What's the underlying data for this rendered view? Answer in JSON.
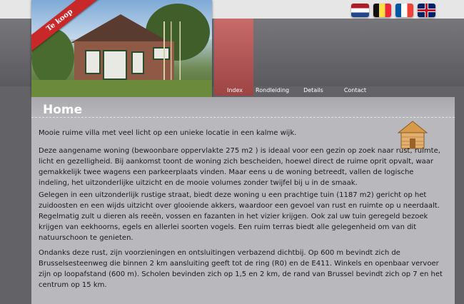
{
  "photo": {
    "ribbon": "Te koop"
  },
  "flags": [
    "nl-flag-icon",
    "be-flag-icon",
    "fr-flag-icon",
    "gb-flag-icon"
  ],
  "nav": {
    "items": [
      "Index",
      "Rondleiding",
      "Details",
      "Contact"
    ]
  },
  "page": {
    "title": "Home"
  },
  "paragraphs": [
    "Mooie ruime villa met veel licht op een unieke locatie in een kalme wijk.",
    "Deze aangename woning (bewoonbare oppervlakte 275 m2 ) is ideaal voor een gezin op zoek naar rust, ruimte, licht en gezelligheid. Bij aankomst toont de woning zich bescheiden, hoewel direct de ruime oprit opvalt, waar gemakkelijk twee wagens een parkeerplaats vinden. Maar eens u de woning betreedt, vallen de logische indeling, het uitzonderlijke uitzicht en de mooie volumes zonder twijfel bij u in de smaak.",
    "Gelegen in een uitzonderlijk rustige straat, biedt deze woning u een prachtige tuin (1187 m2) gericht op het zuidoosten en een wijds uitzicht over glooiende akkers, waardoor een gevoel van rust en ruimte op u neerdaalt. Regelmatig zult u dieren als reeën, vossen en fazanten in het vizier krijgen. Ook zal uw tuin geregeld bezoek krijgen van eekhoorns, egels en allerlei soorten vogels. Een ruim terras biedt alle gelegenheid om van dit natuurschoon te genieten.",
    "Ondanks deze rust, zijn voorzieningen en ontsluitingen verbazend dichtbij. Op 600 m bevindt zich de Brusselsesteenweg die binnen 2 km aansluiting geeft tot de ring (R0) en de E411. Winkels en openbaar vervoer zijn op loopafstand (600 m). Scholen bevinden zich op 1,5 en 2 km, de rand van Brussel bevindt zich op 7 en het centrum op 15 km."
  ]
}
